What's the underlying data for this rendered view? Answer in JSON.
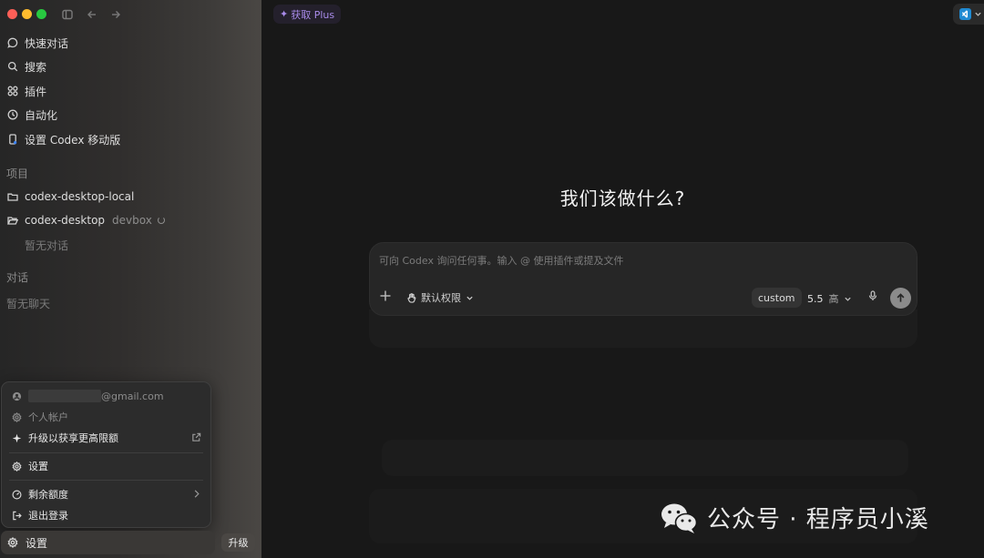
{
  "sidebar": {
    "nav": [
      {
        "label": "快速对话",
        "icon": "chat-bubble-icon"
      },
      {
        "label": "搜索",
        "icon": "search-icon"
      },
      {
        "label": "插件",
        "icon": "plugins-grid-icon"
      },
      {
        "label": "自动化",
        "icon": "clock-icon"
      },
      {
        "label": "设置 Codex 移动版",
        "icon": "mobile-icon"
      }
    ],
    "projects_label": "项目",
    "projects": [
      {
        "name": "codex-desktop-local",
        "tag": ""
      },
      {
        "name": "codex-desktop",
        "tag": "devbox"
      }
    ],
    "project_empty": "暂无对话",
    "chats_label": "对话",
    "chats_empty": "暂无聊天",
    "menu": {
      "email_suffix": "@gmail.com",
      "account": "个人帐户",
      "upgrade": "升级以获享更高限额",
      "settings": "设置",
      "remaining": "剩余额度",
      "logout": "退出登录"
    },
    "settings_label": "设置",
    "upgrade_label": "升级"
  },
  "header": {
    "get_plus": "获取 Plus"
  },
  "main": {
    "title": "我们该做什么?",
    "composer": {
      "placeholder": "可向 Codex 询问任何事。输入 @ 使用插件或提及文件",
      "permission": "默认权限",
      "custom": "custom",
      "model": "5.5",
      "level": "高"
    }
  },
  "watermark": "公众号 · 程序员小溪",
  "colors": {
    "plus_accent": "#a98bea",
    "background": "#181818",
    "vscode_blue": "#1f8ad2"
  }
}
